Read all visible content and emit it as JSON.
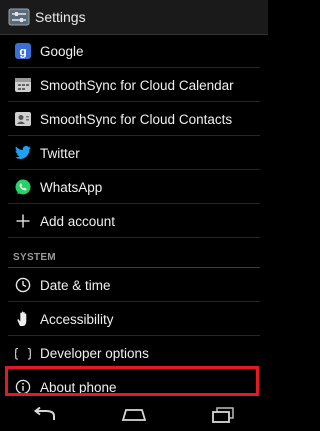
{
  "actionbar": {
    "title": "Settings",
    "icon": "settings-app-icon"
  },
  "accounts": [
    {
      "label": "Google",
      "icon": "google-icon",
      "color": "#3b6fd6"
    },
    {
      "label": "SmoothSync for Cloud Calendar",
      "icon": "calendar-sync-icon"
    },
    {
      "label": "SmoothSync for Cloud Contacts",
      "icon": "contacts-sync-icon"
    },
    {
      "label": "Twitter",
      "icon": "twitter-icon",
      "color": "#1da1f2"
    },
    {
      "label": "WhatsApp",
      "icon": "whatsapp-icon",
      "color": "#25d366"
    },
    {
      "label": "Add account",
      "icon": "plus-icon"
    }
  ],
  "system": {
    "header": "SYSTEM",
    "items": [
      {
        "label": "Date & time",
        "icon": "clock-icon"
      },
      {
        "label": "Accessibility",
        "icon": "hand-icon"
      },
      {
        "label": "Developer options",
        "icon": "braces-icon"
      },
      {
        "label": "About phone",
        "icon": "info-icon"
      }
    ]
  },
  "highlight_color": "#e01b24",
  "navbar": {
    "buttons": [
      "back-icon",
      "home-icon",
      "recents-icon"
    ]
  }
}
